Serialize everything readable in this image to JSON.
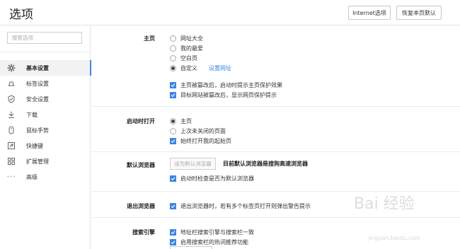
{
  "header": {
    "title": "选项",
    "ie_button": "Internet选项",
    "reset_button": "恢复本页默认"
  },
  "sidebar": {
    "search_placeholder": "搜索选项",
    "items": [
      {
        "label": "基本设置",
        "icon": "gear-icon"
      },
      {
        "label": "标签设置",
        "icon": "tab-icon"
      },
      {
        "label": "安全设置",
        "icon": "shield-check-icon"
      },
      {
        "label": "下载",
        "icon": "download-icon"
      },
      {
        "label": "鼠标手势",
        "icon": "mouse-icon"
      },
      {
        "label": "快捷键",
        "icon": "shortcut-icon"
      },
      {
        "label": "扩展管理",
        "icon": "extensions-icon"
      },
      {
        "label": "高级",
        "icon": "more-icon"
      }
    ]
  },
  "homepage": {
    "label": "主页",
    "options": [
      "网址大全",
      "我的最爱",
      "空白页",
      "自定义"
    ],
    "selected": "自定义",
    "set_url_link": "设置网址",
    "checks": [
      "主页被篡改后，启动时提示主页保护效果",
      "目标网站被篡改后，显示网页保护提示"
    ]
  },
  "startup": {
    "label": "启动时打开",
    "options": [
      "主页",
      "上次未关闭的页面"
    ],
    "selected": "主页",
    "check": "始终打开我的起始页"
  },
  "default_browser": {
    "label": "默认浏览器",
    "button": "设为默认浏览器",
    "status": "目前默认浏览器是搜狗高速浏览器",
    "check": "启动时检查是否为默认浏览器"
  },
  "exit": {
    "label": "退出浏览器",
    "check": "退出浏览器时，若有多个标签页打开则弹出警告提示"
  },
  "search_engine": {
    "label": "搜索引擎",
    "checks": [
      "地址栏搜索引擎与搜索栏一致",
      "启用搜索栏的热词推荐功能"
    ]
  },
  "watermark": {
    "brand": "Bai 经验",
    "url": "jingyan.baidu.com"
  },
  "colors": {
    "accent": "#3b86e3",
    "border": "#e4e4e4"
  }
}
